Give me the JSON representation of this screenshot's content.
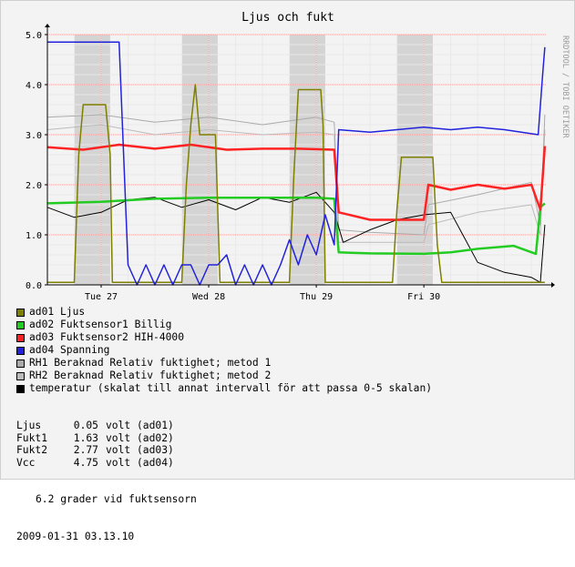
{
  "chart_data": {
    "type": "line",
    "title": "Ljus och fukt",
    "watermark": "RRDTOOL / TOBI OETIKER",
    "ylim": [
      0,
      5
    ],
    "y_ticks": [
      "0.0",
      "1.0",
      "2.0",
      "3.0",
      "4.0",
      "5.0"
    ],
    "x_ticks": [
      "Tue 27",
      "Wed 28",
      "Thu 29",
      "Fri 30"
    ],
    "x_start": "2009-01-26T12:00",
    "x_end": "2009-01-31T03:13",
    "x_tick_times": [
      "2009-01-27T00:00",
      "2009-01-28T00:00",
      "2009-01-29T00:00",
      "2009-01-30T00:00"
    ],
    "day_bands": [
      [
        "2009-01-26T18:00",
        "2009-01-27T02:00"
      ],
      [
        "2009-01-27T18:00",
        "2009-01-28T02:00"
      ],
      [
        "2009-01-28T18:00",
        "2009-01-29T02:00"
      ],
      [
        "2009-01-29T18:00",
        "2009-01-30T02:00"
      ]
    ],
    "grid": true,
    "colors": {
      "ad01": "#7f7f00",
      "ad02": "#22cc22",
      "ad03": "#ff2222",
      "ad04": "#2222dd",
      "RH1": "#aaaaaa",
      "RH2": "#bbbbbb",
      "temperatur": "#000000",
      "band": "#d4d4d4",
      "grid_major": "#ff9a9a",
      "grid_minor": "#e9e9e9"
    },
    "series": [
      {
        "name": "ad01 Ljus",
        "key": "ad01",
        "x": [
          "2009-01-26T12:00",
          "2009-01-26T18:00",
          "2009-01-26T19:00",
          "2009-01-26T20:00",
          "2009-01-27T01:00",
          "2009-01-27T02:00",
          "2009-01-27T02:30",
          "2009-01-27T18:00",
          "2009-01-27T19:00",
          "2009-01-27T20:00",
          "2009-01-27T21:00",
          "2009-01-27T22:00",
          "2009-01-28T01:30",
          "2009-01-28T02:30",
          "2009-01-28T18:00",
          "2009-01-28T19:00",
          "2009-01-28T20:00",
          "2009-01-29T01:00",
          "2009-01-29T01:30",
          "2009-01-29T02:00",
          "2009-01-29T17:00",
          "2009-01-29T18:00",
          "2009-01-29T19:00",
          "2009-01-30T02:00",
          "2009-01-30T03:00",
          "2009-01-30T04:00",
          "2009-01-30T13:00",
          "2009-01-31T03:00"
        ],
        "y": [
          0.05,
          0.05,
          2.6,
          3.6,
          3.6,
          2.6,
          0.05,
          0.05,
          2.0,
          3.2,
          4.0,
          3.0,
          3.0,
          0.05,
          0.05,
          2.2,
          3.9,
          3.9,
          3.2,
          0.05,
          0.05,
          1.5,
          2.55,
          2.55,
          0.8,
          0.05,
          0.05,
          0.05
        ]
      },
      {
        "name": "ad02 Fuktsensor1 Billig",
        "key": "ad02",
        "x": [
          "2009-01-26T12:00",
          "2009-01-27T00:00",
          "2009-01-27T12:00",
          "2009-01-28T00:00",
          "2009-01-28T12:00",
          "2009-01-29T00:00",
          "2009-01-29T04:00",
          "2009-01-29T05:00",
          "2009-01-29T12:00",
          "2009-01-30T00:00",
          "2009-01-30T06:00",
          "2009-01-30T12:00",
          "2009-01-30T20:00",
          "2009-01-31T01:00",
          "2009-01-31T02:00",
          "2009-01-31T03:00"
        ],
        "y": [
          1.63,
          1.66,
          1.72,
          1.74,
          1.74,
          1.74,
          1.72,
          0.65,
          0.63,
          0.62,
          0.65,
          0.72,
          0.78,
          0.62,
          1.55,
          1.63
        ]
      },
      {
        "name": "ad03 Fuktsensor2 HIH-4000",
        "key": "ad03",
        "x": [
          "2009-01-26T12:00",
          "2009-01-26T20:00",
          "2009-01-27T04:00",
          "2009-01-27T12:00",
          "2009-01-27T20:00",
          "2009-01-28T04:00",
          "2009-01-28T12:00",
          "2009-01-28T20:00",
          "2009-01-29T04:00",
          "2009-01-29T05:00",
          "2009-01-29T12:00",
          "2009-01-30T00:00",
          "2009-01-30T01:00",
          "2009-01-30T06:00",
          "2009-01-30T12:00",
          "2009-01-30T18:00",
          "2009-01-31T00:00",
          "2009-01-31T02:00",
          "2009-01-31T03:00"
        ],
        "y": [
          2.75,
          2.7,
          2.8,
          2.72,
          2.8,
          2.7,
          2.72,
          2.72,
          2.7,
          1.45,
          1.3,
          1.3,
          2.0,
          1.9,
          2.0,
          1.92,
          2.0,
          1.5,
          2.77
        ]
      },
      {
        "name": "ad04 Spanning",
        "key": "ad04",
        "x": [
          "2009-01-26T12:00",
          "2009-01-26T22:00",
          "2009-01-27T04:00",
          "2009-01-27T06:00",
          "2009-01-27T08:00",
          "2009-01-27T10:00",
          "2009-01-27T12:00",
          "2009-01-27T14:00",
          "2009-01-27T16:00",
          "2009-01-27T18:00",
          "2009-01-27T20:00",
          "2009-01-27T22:00",
          "2009-01-28T00:00",
          "2009-01-28T02:00",
          "2009-01-28T04:00",
          "2009-01-28T06:00",
          "2009-01-28T08:00",
          "2009-01-28T10:00",
          "2009-01-28T12:00",
          "2009-01-28T14:00",
          "2009-01-28T16:00",
          "2009-01-28T18:00",
          "2009-01-28T20:00",
          "2009-01-28T22:00",
          "2009-01-29T00:00",
          "2009-01-29T02:00",
          "2009-01-29T04:00",
          "2009-01-29T05:00",
          "2009-01-29T12:00",
          "2009-01-29T18:00",
          "2009-01-30T00:00",
          "2009-01-30T06:00",
          "2009-01-30T12:00",
          "2009-01-30T18:00",
          "2009-01-31T01:30",
          "2009-01-31T02:30",
          "2009-01-31T03:00"
        ],
        "y": [
          4.85,
          4.85,
          4.85,
          0.4,
          0.0,
          0.4,
          0.0,
          0.4,
          0.0,
          0.4,
          0.4,
          0.0,
          0.4,
          0.4,
          0.6,
          0.0,
          0.4,
          0.0,
          0.4,
          0.0,
          0.4,
          0.9,
          0.4,
          1.0,
          0.6,
          1.4,
          0.8,
          3.1,
          3.05,
          3.1,
          3.15,
          3.1,
          3.15,
          3.1,
          3.0,
          4.2,
          4.75
        ]
      },
      {
        "name": "RH1 Beraknad Relativ fuktighet; metod 1",
        "key": "RH1",
        "x": [
          "2009-01-26T12:00",
          "2009-01-27T00:00",
          "2009-01-27T12:00",
          "2009-01-28T00:00",
          "2009-01-28T12:00",
          "2009-01-29T00:00",
          "2009-01-29T04:00",
          "2009-01-29T05:00",
          "2009-01-29T12:00",
          "2009-01-30T00:00",
          "2009-01-30T01:00",
          "2009-01-30T12:00",
          "2009-01-31T00:00",
          "2009-01-31T02:00",
          "2009-01-31T03:00"
        ],
        "y": [
          3.35,
          3.4,
          3.25,
          3.35,
          3.2,
          3.35,
          3.25,
          1.1,
          1.05,
          1.0,
          1.6,
          1.8,
          2.05,
          1.2,
          3.4
        ]
      },
      {
        "name": "RH2 Beraknad Relativ fuktighet; metod 2",
        "key": "RH2",
        "x": [
          "2009-01-26T12:00",
          "2009-01-27T00:00",
          "2009-01-27T12:00",
          "2009-01-28T00:00",
          "2009-01-28T12:00",
          "2009-01-29T00:00",
          "2009-01-29T04:00",
          "2009-01-29T05:00",
          "2009-01-29T12:00",
          "2009-01-30T00:00",
          "2009-01-30T01:00",
          "2009-01-30T12:00",
          "2009-01-31T00:00",
          "2009-01-31T02:00",
          "2009-01-31T03:00"
        ],
        "y": [
          3.1,
          3.2,
          3.0,
          3.1,
          3.0,
          3.05,
          3.0,
          0.85,
          0.85,
          0.85,
          1.2,
          1.45,
          1.6,
          1.0,
          3.1
        ]
      },
      {
        "name": "temperatur (skalat till annat intervall för att passa 0-5 skalan)",
        "key": "temperatur",
        "x": [
          "2009-01-26T12:00",
          "2009-01-26T18:00",
          "2009-01-27T00:00",
          "2009-01-27T06:00",
          "2009-01-27T12:00",
          "2009-01-27T18:00",
          "2009-01-28T00:00",
          "2009-01-28T06:00",
          "2009-01-28T12:00",
          "2009-01-28T18:00",
          "2009-01-29T00:00",
          "2009-01-29T04:00",
          "2009-01-29T06:00",
          "2009-01-29T12:00",
          "2009-01-29T18:00",
          "2009-01-30T00:00",
          "2009-01-30T06:00",
          "2009-01-30T12:00",
          "2009-01-30T18:00",
          "2009-01-31T00:00",
          "2009-01-31T02:00",
          "2009-01-31T03:00"
        ],
        "y": [
          1.55,
          1.35,
          1.45,
          1.7,
          1.75,
          1.55,
          1.7,
          1.5,
          1.75,
          1.65,
          1.85,
          1.45,
          0.85,
          1.1,
          1.3,
          1.4,
          1.45,
          0.45,
          0.25,
          0.15,
          0.05,
          1.2
        ]
      }
    ]
  },
  "legend": [
    {
      "key": "ad01",
      "label": "ad01 Ljus"
    },
    {
      "key": "ad02",
      "label": "ad02 Fuktsensor1 Billig"
    },
    {
      "key": "ad03",
      "label": "ad03 Fuktsensor2 HIH-4000"
    },
    {
      "key": "ad04",
      "label": "ad04 Spanning"
    },
    {
      "key": "RH1",
      "label": "RH1 Beraknad Relativ fuktighet; metod 1"
    },
    {
      "key": "RH2",
      "label": "RH2 Beraknad Relativ fuktighet; metod 2"
    },
    {
      "key": "temperatur",
      "label": "temperatur (skalat till annat intervall för att passa 0-5 skalan)"
    }
  ],
  "readout": [
    {
      "label": "Ljus",
      "value": "0.05",
      "unit": "volt (ad01)"
    },
    {
      "label": "Fukt1",
      "value": "1.63",
      "unit": "volt (ad02)"
    },
    {
      "label": "Fukt2",
      "value": "2.77",
      "unit": "volt (ad03)"
    },
    {
      "label": "Vcc",
      "value": "4.75",
      "unit": "volt (ad04)"
    }
  ],
  "temperature_note": "6.2 grader vid fuktsensorn",
  "timestamp": "2009-01-31 03.13.10"
}
